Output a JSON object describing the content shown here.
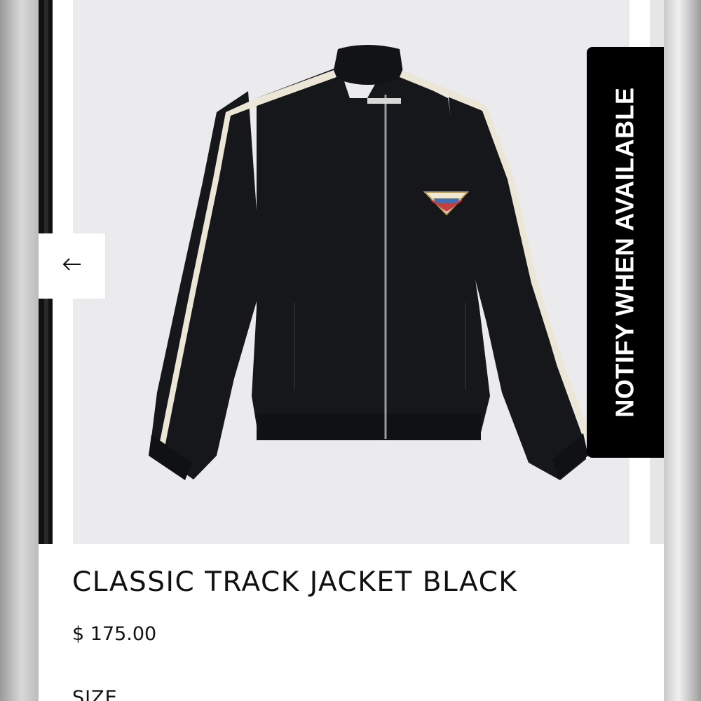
{
  "gallery": {
    "prev_icon": "arrow-left-icon",
    "notify_label": "NOTIFY WHEN AVAILABLE",
    "image_subject": "black track jacket with white stripes"
  },
  "product": {
    "title": "CLASSIC TRACK JACKET BLACK",
    "price": "$ 175.00",
    "size_label": "SIZE"
  },
  "colors": {
    "notify_bg": "#000000",
    "image_bg": "#ebebed",
    "jacket": "#16171b",
    "stripe": "#ece6d6"
  }
}
